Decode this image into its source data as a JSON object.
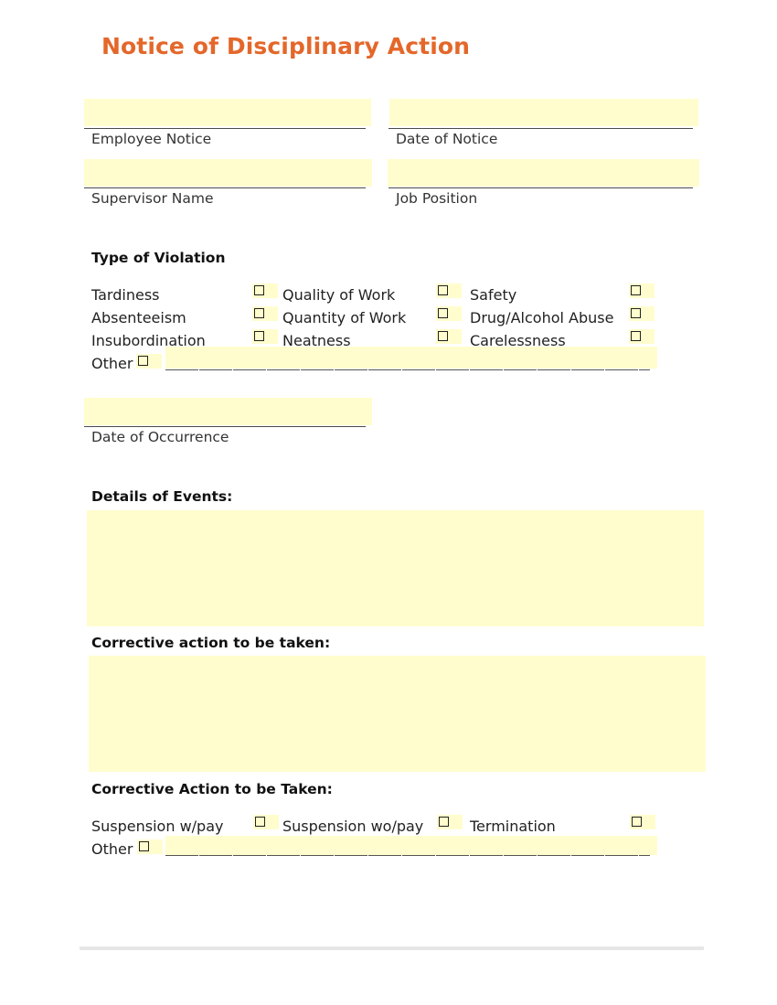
{
  "title": "Notice of Disciplinary Action",
  "fields": {
    "employee_notice": {
      "label": "Employee Notice",
      "value": ""
    },
    "date_of_notice": {
      "label": "Date of Notice",
      "value": ""
    },
    "supervisor_name": {
      "label": "Supervisor Name",
      "value": ""
    },
    "job_position": {
      "label": "Job Position",
      "value": ""
    },
    "date_of_occurrence": {
      "label": "Date of Occurrence",
      "value": ""
    }
  },
  "violation": {
    "heading": "Type of Violation",
    "options": [
      {
        "label": "Tardiness",
        "checked": false
      },
      {
        "label": "Quality of Work",
        "checked": false
      },
      {
        "label": "Safety",
        "checked": false
      },
      {
        "label": "Absenteeism",
        "checked": false
      },
      {
        "label": "Quantity of Work",
        "checked": false
      },
      {
        "label": "Drug/Alcohol Abuse",
        "checked": false
      },
      {
        "label": "Insubordination",
        "checked": false
      },
      {
        "label": "Neatness",
        "checked": false
      },
      {
        "label": "Carelessness",
        "checked": false
      }
    ],
    "other": {
      "label": "Other",
      "checked": false,
      "value": ""
    }
  },
  "details": {
    "heading": "Details of Events:",
    "value": ""
  },
  "corrective_text": {
    "heading": "Corrective action to be taken:",
    "value": ""
  },
  "corrective_choice": {
    "heading": "Corrective Action to be Taken:",
    "options": [
      {
        "label": "Suspension w/pay",
        "checked": false
      },
      {
        "label": "Suspension wo/pay",
        "checked": false
      },
      {
        "label": "Termination",
        "checked": false
      }
    ],
    "other": {
      "label": "Other",
      "checked": false,
      "value": ""
    }
  }
}
